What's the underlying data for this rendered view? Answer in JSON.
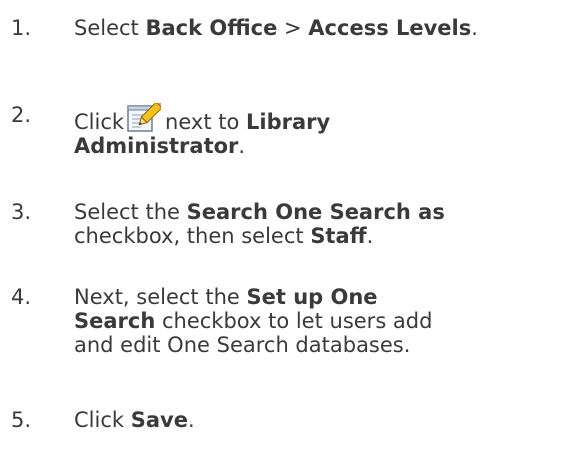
{
  "steps": [
    {
      "number": "1.",
      "prefix": "Select ",
      "bold1": "Back Office",
      "mid1": " > ",
      "bold2": "Access Levels",
      "suffix": "."
    },
    {
      "number": "2.",
      "prefix": "Click",
      "icon": "edit-pencil-icon",
      "mid1": "next to ",
      "bold1": "Library",
      "bold2": "Administrator",
      "suffix": "."
    },
    {
      "number": "3.",
      "prefix": "Select the ",
      "bold1": "Search One Search as",
      "mid1": "checkbox, then select ",
      "bold2": "Staff",
      "suffix": "."
    },
    {
      "number": "4.",
      "prefix": "Next, select the ",
      "bold1": "Set up One",
      "bold2": "Search",
      "mid1": " checkbox to let users add",
      "line3": "and edit One Search databases."
    },
    {
      "number": "5.",
      "prefix": "Click ",
      "bold1": "Save",
      "suffix": "."
    }
  ]
}
